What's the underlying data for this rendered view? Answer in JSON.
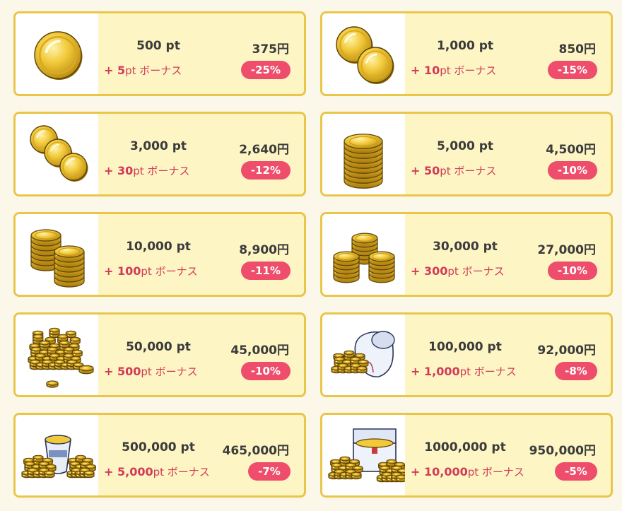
{
  "bonus_suffix": "ボーナス",
  "colors": {
    "border": "#e9c64a",
    "card_bg": "#fdf5c4",
    "badge": "#ee4d6b",
    "bonus_text": "#d23a57"
  },
  "packages": [
    {
      "points": "500 pt",
      "price": "375円",
      "bonus": "5",
      "discount": "-25%",
      "icon": "single-coin-icon"
    },
    {
      "points": "1,000 pt",
      "price": "850円",
      "bonus": "10",
      "discount": "-15%",
      "icon": "two-coins-icon"
    },
    {
      "points": "3,000 pt",
      "price": "2,640円",
      "bonus": "30",
      "discount": "-12%",
      "icon": "three-coins-icon"
    },
    {
      "points": "5,000 pt",
      "price": "4,500円",
      "bonus": "50",
      "discount": "-10%",
      "icon": "coin-stack-icon"
    },
    {
      "points": "10,000 pt",
      "price": "8,900円",
      "bonus": "100",
      "discount": "-11%",
      "icon": "two-coin-stacks-icon"
    },
    {
      "points": "30,000 pt",
      "price": "27,000円",
      "bonus": "300",
      "discount": "-10%",
      "icon": "three-coin-stacks-icon"
    },
    {
      "points": "50,000 pt",
      "price": "45,000円",
      "bonus": "500",
      "discount": "-10%",
      "icon": "coin-pile-icon"
    },
    {
      "points": "100,000 pt",
      "price": "92,000円",
      "bonus": "1,000",
      "discount": "-8%",
      "icon": "coin-sack-icon"
    },
    {
      "points": "500,000 pt",
      "price": "465,000円",
      "bonus": "5,000",
      "discount": "-7%",
      "icon": "coin-bucket-icon"
    },
    {
      "points": "1000,000 pt",
      "price": "950,000円",
      "bonus": "10,000",
      "discount": "-5%",
      "icon": "treasure-chest-icon"
    }
  ]
}
